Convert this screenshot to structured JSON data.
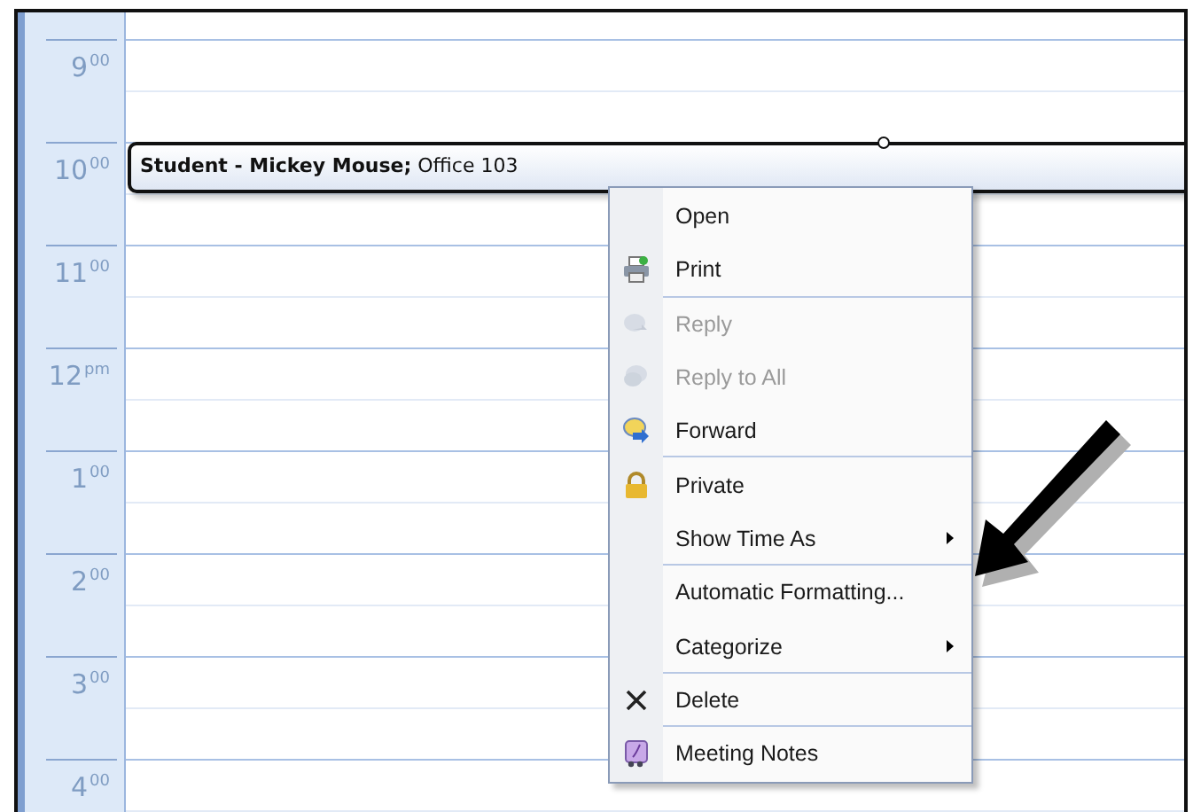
{
  "time_slots": [
    {
      "label": "9$^{00}$"
    },
    {
      "label": "10$^{00}$"
    },
    {
      "label": "11$^{00}$"
    },
    {
      "label": "12$^{pm}$"
    },
    {
      "label": "1$^{00}$"
    },
    {
      "label": "2$^{00}$"
    },
    {
      "label": "3$^{00}$"
    },
    {
      "label": "4$^{00}$"
    }
  ],
  "appointment": {
    "title": "Student - Mickey Mouse;",
    "location": "Office 103",
    "selected": true
  },
  "context_menu": {
    "items": [
      {
        "label": "Open",
        "kind": "open",
        "disabled": false,
        "submenu": false,
        "separator_after": false
      },
      {
        "label": "Print",
        "kind": "print",
        "disabled": false,
        "submenu": false,
        "separator_after": true
      },
      {
        "label": "Reply",
        "kind": "reply",
        "disabled": true,
        "submenu": false,
        "separator_after": false
      },
      {
        "label": "Reply to All",
        "kind": "reply-all",
        "disabled": true,
        "submenu": false,
        "separator_after": false
      },
      {
        "label": "Forward",
        "kind": "forward",
        "disabled": false,
        "submenu": false,
        "separator_after": true
      },
      {
        "label": "Private",
        "kind": "private",
        "disabled": false,
        "submenu": false,
        "separator_after": false
      },
      {
        "label": "Show Time As",
        "kind": "plain",
        "disabled": false,
        "submenu": true,
        "separator_after": true
      },
      {
        "label": "Automatic Formatting...",
        "kind": "plain",
        "disabled": false,
        "submenu": false,
        "separator_after": false
      },
      {
        "label": "Categorize",
        "kind": "plain",
        "disabled": false,
        "submenu": true,
        "separator_after": true
      },
      {
        "label": "Delete",
        "kind": "delete",
        "disabled": false,
        "submenu": false,
        "separator_after": true
      },
      {
        "label": "Meeting Notes",
        "kind": "notes",
        "disabled": false,
        "submenu": false,
        "separator_after": false
      }
    ]
  }
}
